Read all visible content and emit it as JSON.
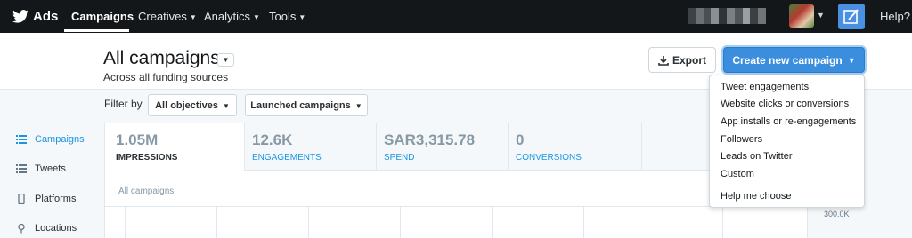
{
  "nav": {
    "brand": "Ads",
    "items": [
      {
        "label": "Campaigns",
        "active": true
      },
      {
        "label": "Creatives",
        "active": false
      },
      {
        "label": "Analytics",
        "active": false
      },
      {
        "label": "Tools",
        "active": false
      }
    ],
    "help": "Help?"
  },
  "header": {
    "title": "All campaigns",
    "subtitle": "Across all funding sources",
    "export_label": "Export",
    "create_label": "Create new campaign"
  },
  "filters": {
    "label": "Filter by",
    "objectives": "All objectives",
    "status": "Launched campaigns"
  },
  "sidebar": {
    "items": [
      {
        "label": "Campaigns",
        "icon": "list-icon",
        "active": true
      },
      {
        "label": "Tweets",
        "icon": "list-icon",
        "active": false
      },
      {
        "label": "Platforms",
        "icon": "phone-icon",
        "active": false
      },
      {
        "label": "Locations",
        "icon": "pin-icon",
        "active": false
      }
    ]
  },
  "metrics": [
    {
      "value": "1.05M",
      "label": "IMPRESSIONS",
      "active": true
    },
    {
      "value": "12.6K",
      "label": "ENGAGEMENTS",
      "active": false
    },
    {
      "value": "SAR3,315.78",
      "label": "SPEND",
      "active": false
    },
    {
      "value": "0",
      "label": "CONVERSIONS",
      "active": false
    }
  ],
  "chart": {
    "label": "All campaigns",
    "axis_label": "300.0K"
  },
  "create_menu": {
    "items": [
      "Tweet engagements",
      "Website clicks or conversions",
      "App installs or re-engagements",
      "Followers",
      "Leads on Twitter",
      "Custom"
    ],
    "footer": "Help me choose"
  },
  "colors": {
    "nav_bg": "#14171a",
    "accent": "#1b95e0",
    "create_button": "#3a8edd"
  }
}
